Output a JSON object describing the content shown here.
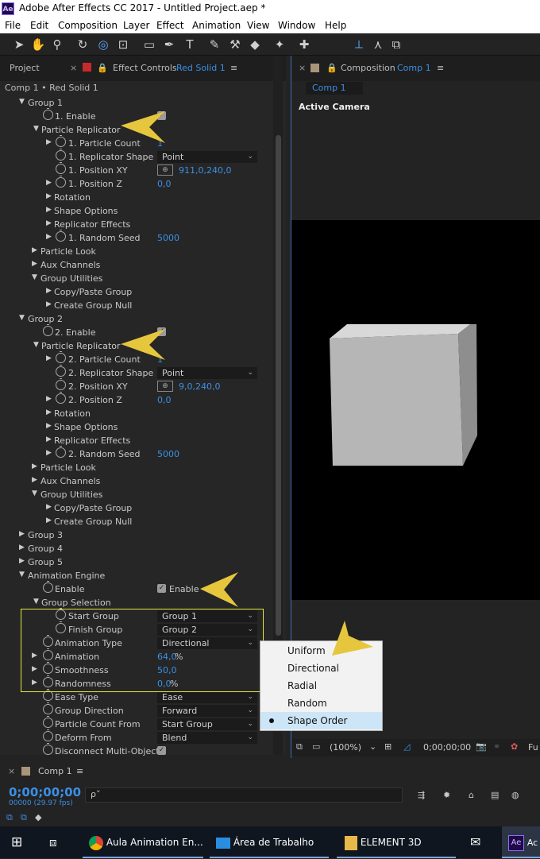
{
  "window": {
    "title": "Adobe After Effects CC 2017 - Untitled Project.aep *",
    "app_icon": "Ae"
  },
  "menu": [
    "File",
    "Edit",
    "Composition",
    "Layer",
    "Effect",
    "Animation",
    "View",
    "Window",
    "Help"
  ],
  "left_panel": {
    "tab_project": "Project",
    "tab_effect_controls": "Effect Controls",
    "tab_effect_layer": "Red Solid 1",
    "breadcrumb": "Comp 1 • Red Solid 1"
  },
  "params": {
    "group1": "Group 1",
    "g1_enable": "1. Enable",
    "g1_replicator": "Particle Replicator",
    "g1_count": "1. Particle Count",
    "g1_count_val": "1",
    "g1_shape": "1. Replicator Shape",
    "g1_shape_val": "Point",
    "g1_posxy": "1. Position XY",
    "g1_posxy_val": "911,0,240,0",
    "g1_posz": "1. Position Z",
    "g1_posz_val": "0,0",
    "rotation": "Rotation",
    "shape_options": "Shape Options",
    "replicator_effects": "Replicator Effects",
    "g1_seed": "1. Random Seed",
    "g1_seed_val": "5000",
    "particle_look": "Particle Look",
    "aux_channels": "Aux Channels",
    "group_utilities": "Group Utilities",
    "copy_paste": "Copy/Paste Group",
    "create_null": "Create Group Null",
    "group2": "Group 2",
    "g2_enable": "2. Enable",
    "g2_replicator": "Particle Replicator",
    "g2_count": "2. Particle Count",
    "g2_count_val": "1",
    "g2_shape": "2. Replicator Shape",
    "g2_shape_val": "Point",
    "g2_posxy": "2. Position XY",
    "g2_posxy_val": "9,0,240,0",
    "g2_posz": "2. Position Z",
    "g2_posz_val": "0,0",
    "g2_seed": "2. Random Seed",
    "g2_seed_val": "5000",
    "group3": "Group 3",
    "group4": "Group 4",
    "group5": "Group 5",
    "anim_engine": "Animation Engine",
    "enable": "Enable",
    "enable_cb_label": "Enable",
    "group_selection": "Group Selection",
    "start_group": "Start Group",
    "start_group_val": "Group 1",
    "finish_group": "Finish Group",
    "finish_group_val": "Group 2",
    "anim_type": "Animation Type",
    "anim_type_val": "Directional",
    "animation": "Animation",
    "animation_val": "64,0",
    "smoothness": "Smoothness",
    "smoothness_val": "50,0",
    "randomness": "Randomness",
    "randomness_val": "0,0",
    "pct": "%",
    "ease_type": "Ease Type",
    "ease_type_val": "Ease",
    "group_direction": "Group Direction",
    "group_direction_val": "Forward",
    "count_from": "Particle Count From",
    "count_from_val": "Start Group",
    "deform_from": "Deform From",
    "deform_from_val": "Blend",
    "disconnect": "Disconnect Multi-Object"
  },
  "right_panel": {
    "tab_label": "Composition",
    "tab_comp": "Comp 1",
    "comp_tab": "Comp 1",
    "active_camera": "Active Camera",
    "zoom": "(100%)",
    "timecode": "0;00;00;00",
    "quality": "Fu"
  },
  "popup": {
    "options": [
      "Uniform",
      "Directional",
      "Radial",
      "Random",
      "Shape Order"
    ],
    "selected_index": 4
  },
  "timeline": {
    "tab": "Comp 1",
    "timecode": "0;00;00;00",
    "frames": "00000 (29.97 fps)",
    "search_placeholder": "ρ˅"
  },
  "taskbar": {
    "items": [
      "Aula Animation En...",
      "Área de Trabalho",
      "ELEMENT 3D",
      "Ae"
    ]
  },
  "colors": {
    "accent": "#3b8fe6",
    "annotation": "#e6c63d",
    "highlight_box": "#e6e63d"
  }
}
